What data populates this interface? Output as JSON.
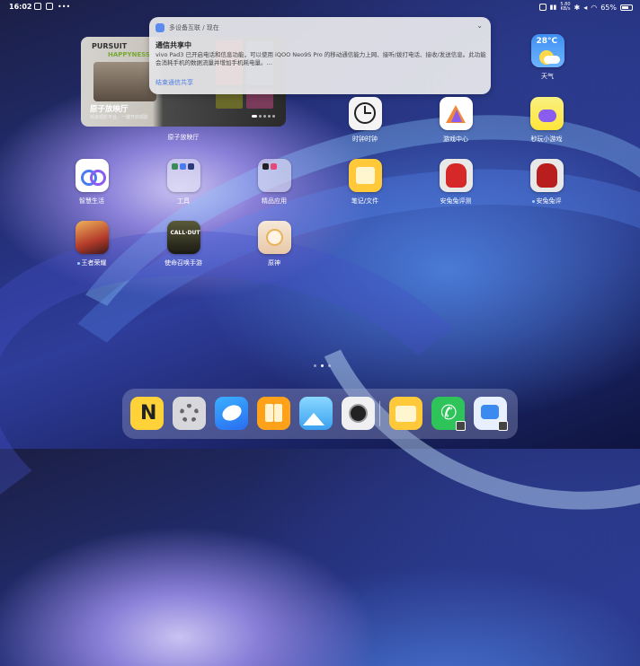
{
  "status": {
    "time": "16:02",
    "battery": "65%",
    "speed_value": "5.80",
    "speed_unit": "KB/s"
  },
  "notification": {
    "app_name": "多设备互联 / 现在",
    "title": "通信共享中",
    "body": "vivo Pad3 已开启电话和信息功能，可以使用 iQOO Neo9S Pro 的移动通信能力上网、接听/拨打电话、接收/发送信息。此功能会消耗手机的数据流量并增加手机耗电量。…",
    "action": "结束通信共享"
  },
  "widget": {
    "title": "原子放映厅",
    "subtitle": "快速观影平台，一键开启观影",
    "poster_text_1": "PURSUIT",
    "poster_text_2": "HAPPYNESS",
    "label": "原子放映厅"
  },
  "apps": {
    "weather": {
      "label": "天气",
      "temp": "28°C"
    },
    "clock": {
      "label": "时钟时钟"
    },
    "game_center": {
      "label": "游戏中心"
    },
    "mini_games": {
      "label": "秒玩小游戏"
    },
    "smart_life": {
      "label": "智慧生活"
    },
    "tools": {
      "label": "工具"
    },
    "featured_apps": {
      "label": "精品应用"
    },
    "notes": {
      "label": "笔记/文件"
    },
    "antutu": {
      "label": "安兔兔评测"
    },
    "antutu3d": {
      "label": "安兔兔评"
    },
    "honor_of_kings": {
      "label": "王者荣耀"
    },
    "cod": {
      "label": "使命召唤手游"
    },
    "genshin": {
      "label": "原神"
    }
  },
  "dock": {
    "notes_glyph": "N"
  }
}
